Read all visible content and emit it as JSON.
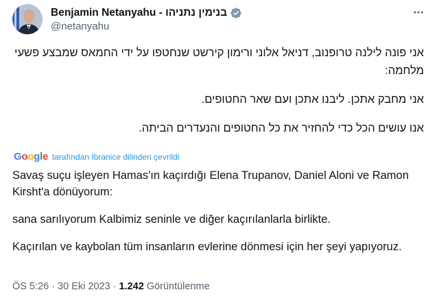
{
  "author": {
    "display_name": "Benjamin Netanyahu - בנימין נתניהו",
    "handle": "@netanyahu"
  },
  "tweet": {
    "original_paragraphs": [
      "אני פונה לילנה טרופנוב, דניאל אלוני ורימון קירשט שנחטפו על ידי החמאס שמבצע פשעי מלחמה:",
      "אני מחבק אתכן. ליבנו אתכן ועם שאר החטופים.",
      "אנו עושים הכל כדי להחזיר את כל החטופים והנעדרים הביתה."
    ],
    "translation_provider": "Google",
    "translation_label": "tarafından İbranice dilinden çevrildi",
    "translated_paragraphs": [
      "Savaş suçu işleyen Hamas'ın kaçırdığı Elena Trupanov, Daniel Aloni ve Ramon Kirsht'a dönüyorum:",
      "sana sarılıyorum Kalbimiz seninle ve diğer kaçırılanlarla birlikte.",
      "Kaçırılan ve kaybolan tüm insanların evlerine dönmesi için her şeyi yapıyoruz."
    ]
  },
  "meta": {
    "time": "ÖS 5:26",
    "date": "30 Eki 2023",
    "separator": "·",
    "views_count": "1.242",
    "views_label": "Görüntülenme"
  },
  "icons": {
    "verified": "verified-badge-icon",
    "more": "more-options-icon"
  },
  "colors": {
    "accent": "#1d9bf0",
    "text": "#0f1419",
    "secondary": "#536471"
  }
}
